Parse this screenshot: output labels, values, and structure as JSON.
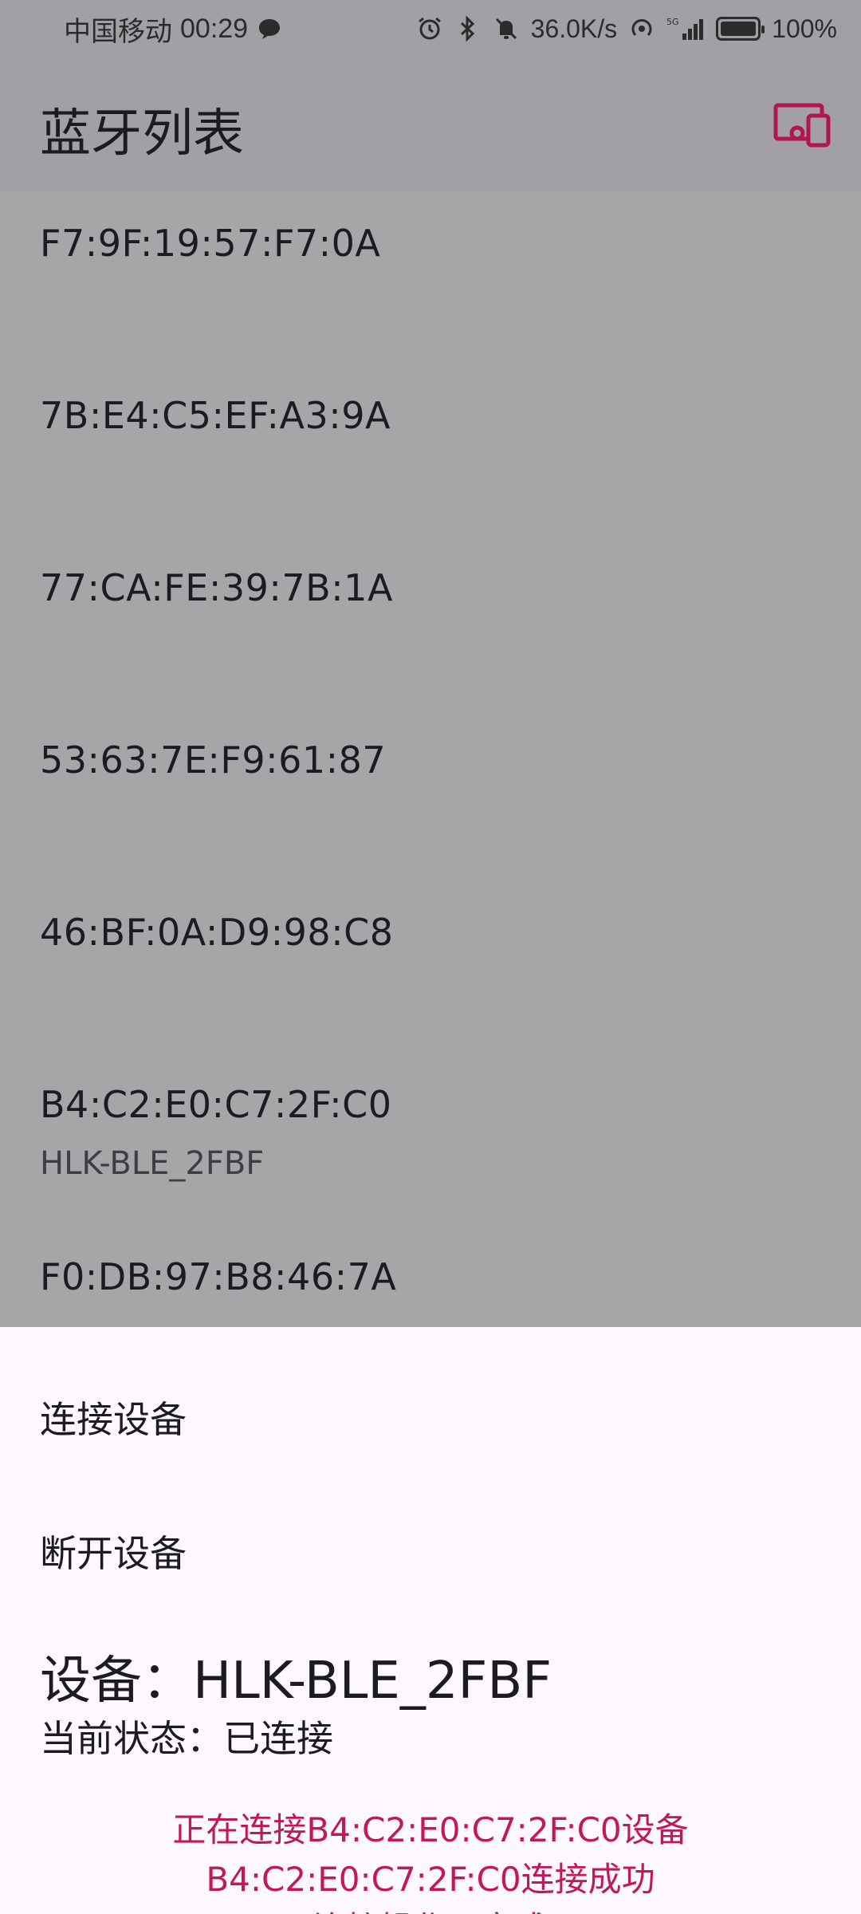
{
  "status_bar": {
    "carrier": "中国移动",
    "time": "00:29",
    "net_speed": "36.0K/s",
    "battery": "100%",
    "icons": [
      "message-icon",
      "alarm-icon",
      "bluetooth-icon",
      "mute-icon",
      "hotspot-icon",
      "signal-5g-icon",
      "battery-icon"
    ]
  },
  "app_bar": {
    "title": "蓝牙列表",
    "action_icon": "devices-icon",
    "accent": "#b0174d"
  },
  "devices": [
    {
      "address": "F7:9F:19:57:F7:0A",
      "name": ""
    },
    {
      "address": "7B:E4:C5:EF:A3:9A",
      "name": ""
    },
    {
      "address": "77:CA:FE:39:7B:1A",
      "name": ""
    },
    {
      "address": "53:63:7E:F9:61:87",
      "name": ""
    },
    {
      "address": "46:BF:0A:D9:98:C8",
      "name": ""
    },
    {
      "address": "B4:C2:E0:C7:2F:C0",
      "name": "HLK-BLE_2FBF"
    },
    {
      "address": "F0:DB:97:B8:46:7A",
      "name": ""
    }
  ],
  "sheet": {
    "connect_label": "连接设备",
    "disconnect_label": "断开设备",
    "device_title": "设备：HLK-BLE_2FBF",
    "state": "当前状态：已连接",
    "log_lines": [
      "正在连接B4:C2:E0:C7:2F:C0设备",
      "B4:C2:E0:C7:2F:C0连接成功",
      "连接操作已完成"
    ],
    "log_color": "#c2185b"
  }
}
